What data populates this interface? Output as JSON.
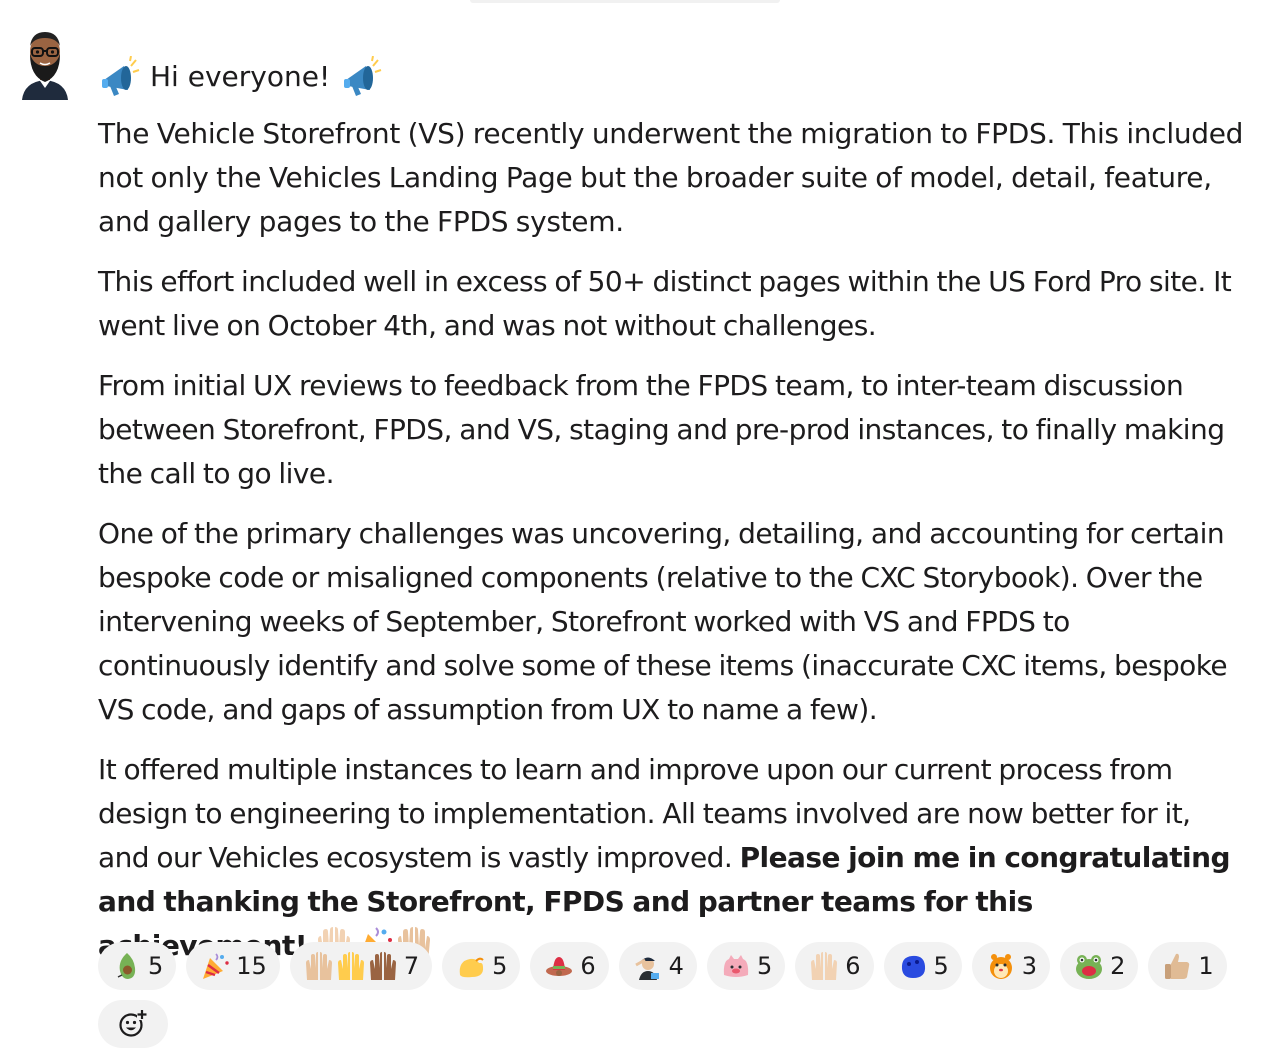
{
  "message": {
    "greeting": "Hi everyone!",
    "paragraphs": [
      "The Vehicle Storefront (VS) recently underwent the migration to FPDS. This included not only the Vehicles Landing Page but the broader suite of model, detail, feature, and gallery pages to the FPDS system.",
      "This effort included well in excess of 50+ distinct pages within the US Ford Pro site. It went live on October 4th, and was not without challenges.",
      "From initial UX reviews to feedback from the FPDS team, to inter-team discussion between Storefront, FPDS, and VS, staging and pre-prod instances, to finally making the call to go live.",
      "One of the primary challenges was uncovering, detailing, and accounting for certain bespoke code or misaligned components (relative to the CXC Storybook). Over the intervening weeks of September, Storefront worked with VS and FPDS to continuously identify and solve some of these items (inaccurate CXC items, bespoke VS code, and gaps of assumption from UX to name a few)."
    ],
    "closing_normal": "It offered multiple instances to learn and improve upon our current process from design to engineering to implementation. All teams involved are now better for it, and our Vehicles ecosystem is vastly improved. ",
    "closing_bold": "Please join me in congratulating and thanking the Storefront, FPDS and partner teams for this achievement!"
  },
  "reactions": [
    {
      "icons": [
        "avocado-icon"
      ],
      "count": "5"
    },
    {
      "icons": [
        "party-popper-icon"
      ],
      "count": "15"
    },
    {
      "icons": [
        "raised-hands-light-icon",
        "raised-hands-yellow-icon",
        "raised-hands-dark-icon"
      ],
      "count": "7"
    },
    {
      "icons": [
        "yellow-blob-icon"
      ],
      "count": "5"
    },
    {
      "icons": [
        "sombrero-icon"
      ],
      "count": "6"
    },
    {
      "icons": [
        "salute-man-icon"
      ],
      "count": "4"
    },
    {
      "icons": [
        "pink-pig-icon"
      ],
      "count": "5"
    },
    {
      "icons": [
        "raised-hands-light-icon"
      ],
      "count": "6"
    },
    {
      "icons": [
        "blue-blob-icon"
      ],
      "count": "5"
    },
    {
      "icons": [
        "hamster-icon"
      ],
      "count": "3"
    },
    {
      "icons": [
        "frog-icon"
      ],
      "count": "2"
    },
    {
      "icons": [
        "thumbs-up-icon"
      ],
      "count": "1"
    }
  ],
  "colors": {
    "text": "#1d1c1d",
    "reaction_bg": "#f2f2f2"
  }
}
